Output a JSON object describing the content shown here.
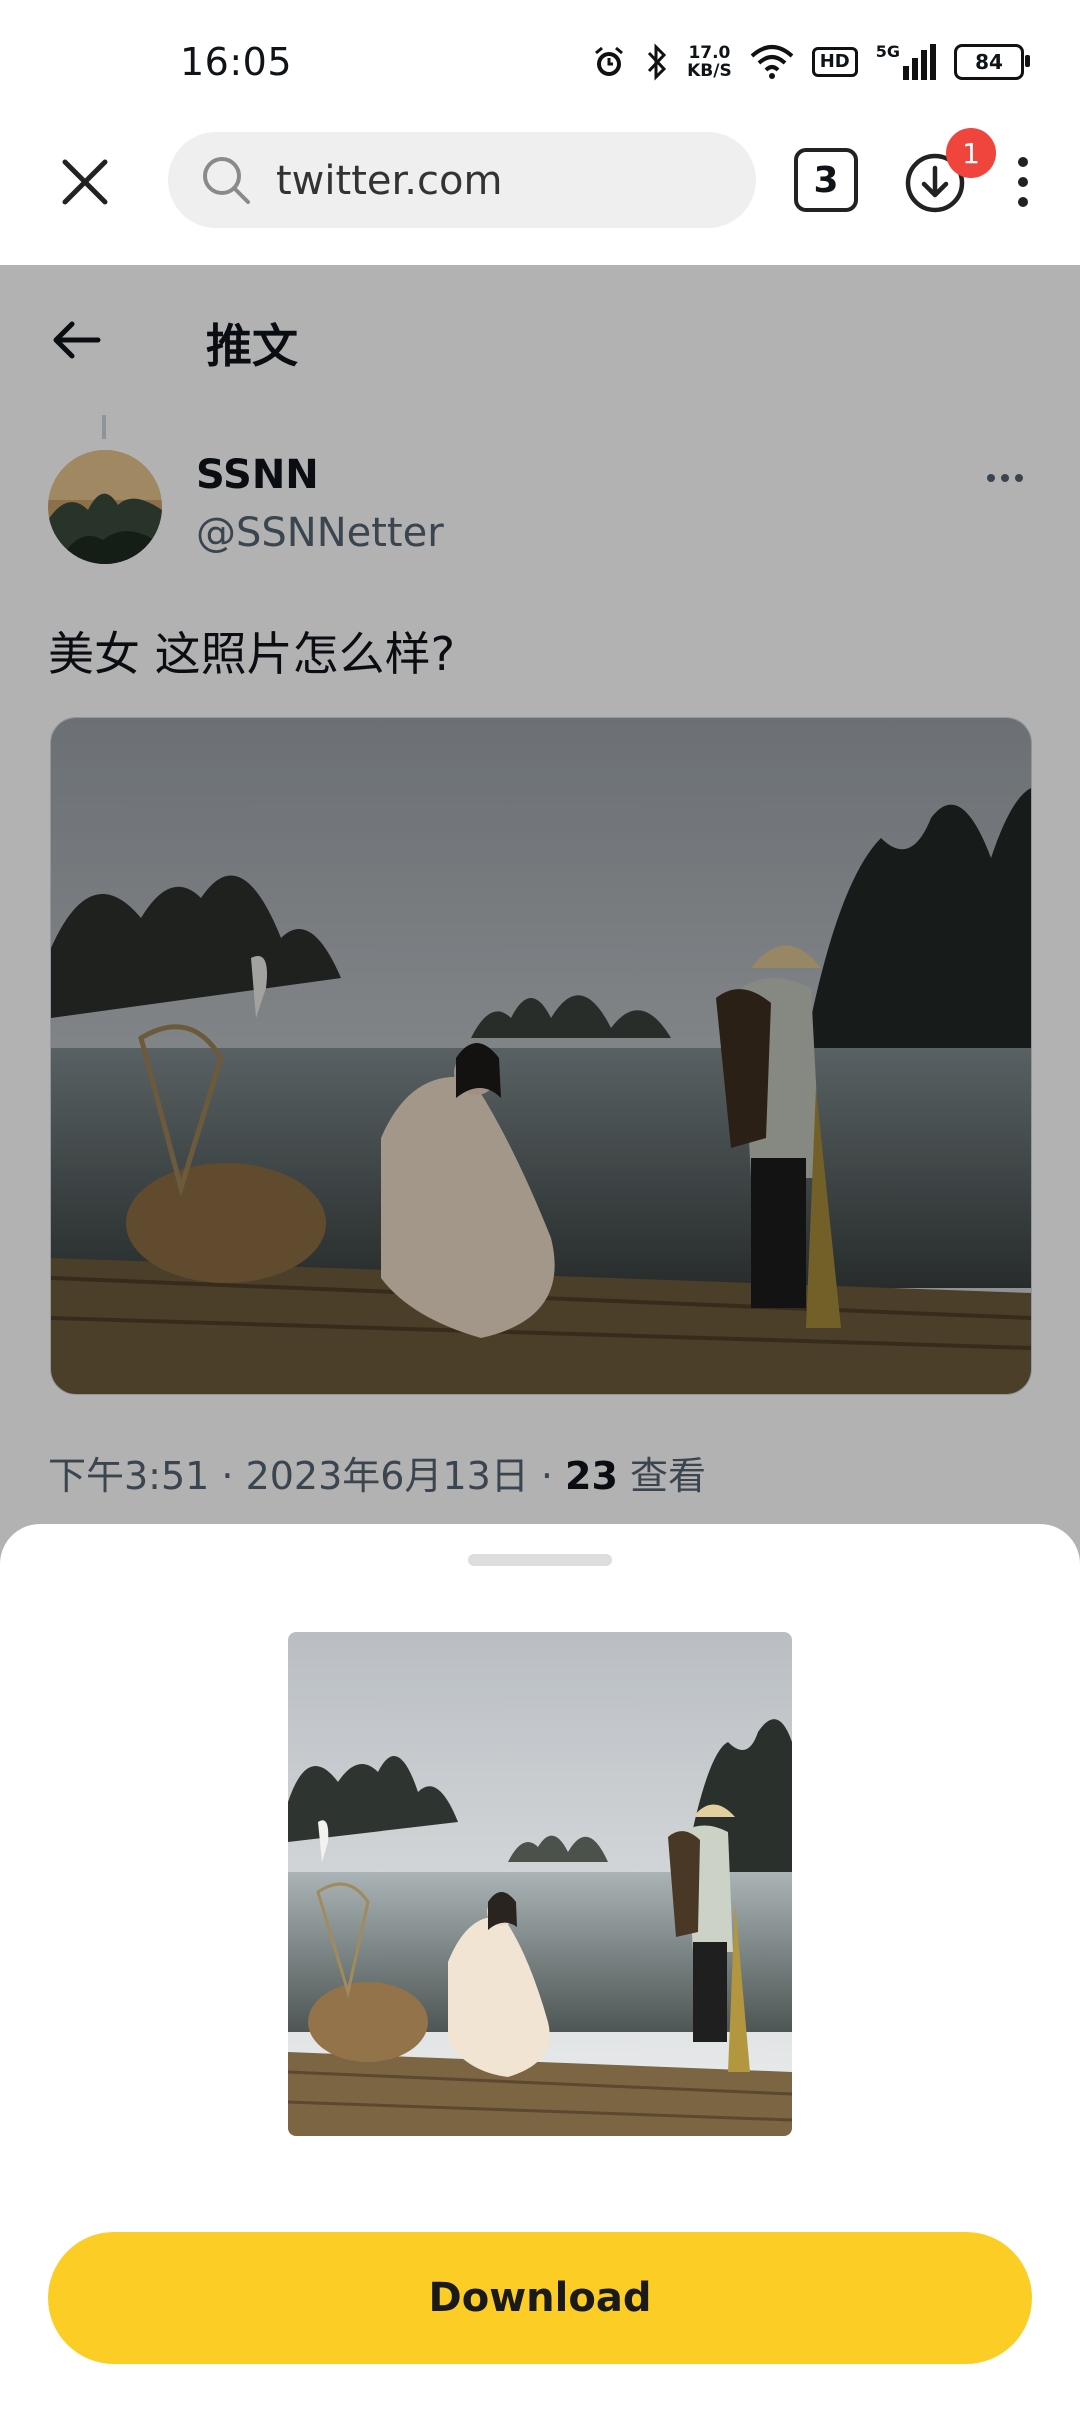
{
  "status_bar": {
    "time": "16:05",
    "speed_value": "17.0",
    "speed_unit": "KB/S",
    "hd_label": "HD",
    "network_label": "5G",
    "battery": "84"
  },
  "browser": {
    "url": "twitter.com",
    "tab_count": "3",
    "download_badge": "1"
  },
  "tweet_page": {
    "title": "推文",
    "author_name": "SSNN",
    "author_handle": "@SSNNetter",
    "text": "美女 这照片怎么样?",
    "meta_prefix": "下午3:51 · 2023年6月13日 · ",
    "views_count": "23",
    "views_label": " 查看"
  },
  "sheet": {
    "download_label": "Download"
  },
  "colors": {
    "accent_yellow": "#fbcd25",
    "badge_red": "#f0453d",
    "dim_overlay": "rgba(0,0,0,0.30)"
  },
  "icons": [
    "close-icon",
    "search-icon",
    "download-icon",
    "more-vertical-icon",
    "back-arrow-icon",
    "more-horizontal-icon",
    "alarm-icon",
    "bluetooth-icon",
    "wifi-icon"
  ]
}
